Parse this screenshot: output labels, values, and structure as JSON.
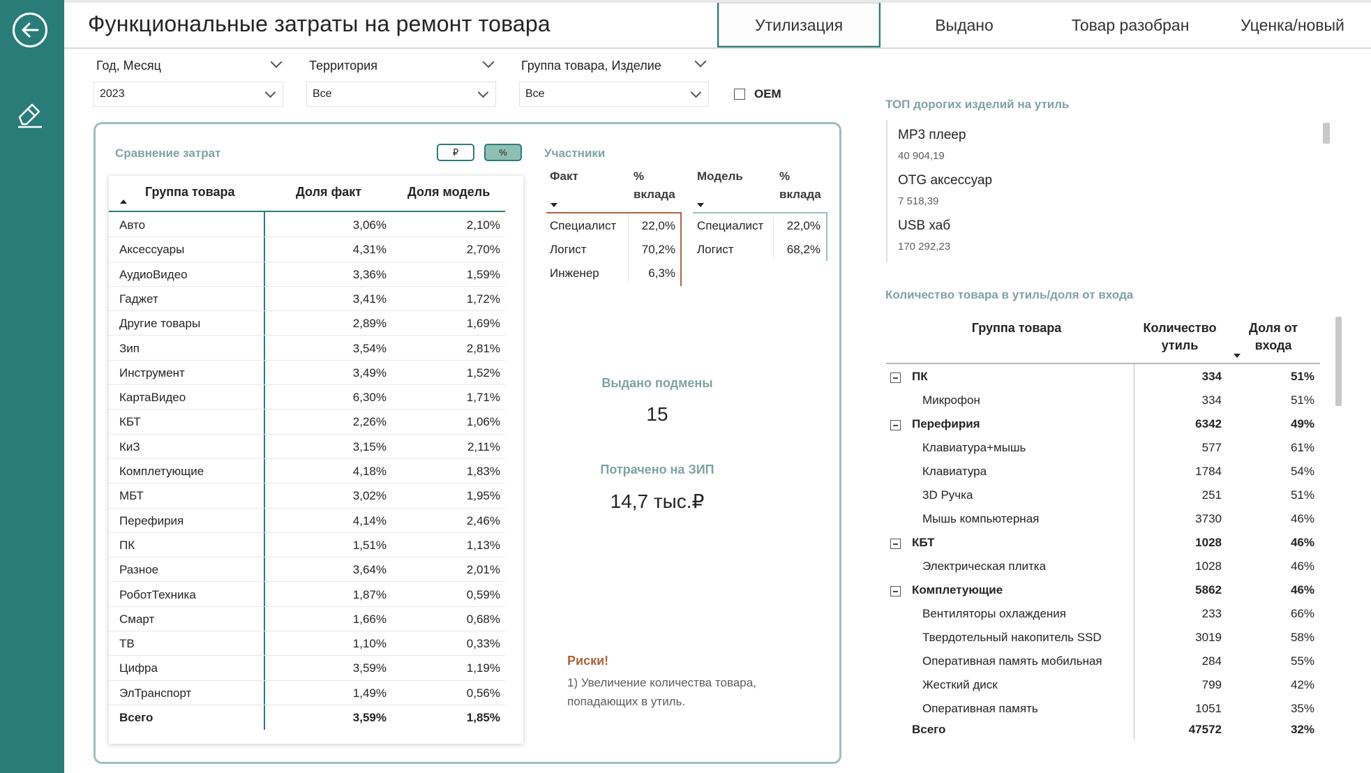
{
  "header": {
    "title": "Функциональные затраты на ремонт товара",
    "tabs": [
      {
        "label": "Утилизация",
        "active": true
      },
      {
        "label": "Выдано",
        "active": false
      },
      {
        "label": "Товар разобран",
        "active": false
      },
      {
        "label": "Уценка/новый",
        "active": false
      }
    ]
  },
  "sidebar": {
    "back_icon": "arrow-left-circle-icon",
    "clear_icon": "eraser-icon"
  },
  "filters": {
    "year_month": {
      "label": "Год, Месяц",
      "value": "2023"
    },
    "territory": {
      "label": "Территория",
      "value": "Все"
    },
    "product_group": {
      "label": "Группа товара, Изделие",
      "value": "Все"
    },
    "oem": {
      "label": "OEM",
      "checked": false
    }
  },
  "comparison": {
    "title": "Сравнение затрат",
    "toggle_rub": "₽",
    "toggle_pct": "%",
    "columns": [
      "Группа товара",
      "Доля факт",
      "Доля модель"
    ],
    "rows": [
      [
        "Авто",
        "3,06%",
        "2,10%"
      ],
      [
        "Аксессуары",
        "4,31%",
        "2,70%"
      ],
      [
        "АудиоВидео",
        "3,36%",
        "1,59%"
      ],
      [
        "Гаджет",
        "3,41%",
        "1,72%"
      ],
      [
        "Другие товары",
        "2,89%",
        "1,69%"
      ],
      [
        "Зип",
        "3,54%",
        "2,81%"
      ],
      [
        "Инструмент",
        "3,49%",
        "1,52%"
      ],
      [
        "КартаВидео",
        "6,30%",
        "1,71%"
      ],
      [
        "КБТ",
        "2,26%",
        "1,06%"
      ],
      [
        "КиЗ",
        "3,15%",
        "2,11%"
      ],
      [
        "Комплетующие",
        "4,18%",
        "1,83%"
      ],
      [
        "МБТ",
        "3,02%",
        "1,95%"
      ],
      [
        "Перефирия",
        "4,14%",
        "2,46%"
      ],
      [
        "ПК",
        "1,51%",
        "1,13%"
      ],
      [
        "Разное",
        "3,64%",
        "2,01%"
      ],
      [
        "РоботТехника",
        "1,87%",
        "0,59%"
      ],
      [
        "Смарт",
        "1,66%",
        "0,68%"
      ],
      [
        "ТВ",
        "1,10%",
        "0,33%"
      ],
      [
        "Цифра",
        "3,59%",
        "1,19%"
      ],
      [
        "ЭлТранспорт",
        "1,49%",
        "0,56%"
      ]
    ],
    "total": [
      "Всего",
      "3,59%",
      "1,85%"
    ]
  },
  "participants": {
    "title": "Участники",
    "fact": {
      "col1": "Факт",
      "col2": "% вклада",
      "rows": [
        [
          "Специалист",
          "22,0%"
        ],
        [
          "Логист",
          "70,2%"
        ],
        [
          "Инженер",
          "6,3%"
        ]
      ]
    },
    "model": {
      "col1": "Модель",
      "col2": "% вклада",
      "rows": [
        [
          "Специалист",
          "22,0%"
        ],
        [
          "Логист",
          "68,2%"
        ]
      ]
    }
  },
  "kpis": {
    "replacements": {
      "label": "Выдано подмены",
      "value": "15"
    },
    "zip_spent": {
      "label": "Потрачено на ЗИП",
      "value": "14,7 тыс.₽"
    }
  },
  "risks": {
    "title": "Риски!",
    "line1": "1) Увеличение количества товара,",
    "line2": "попадающих в утиль."
  },
  "top_expensive": {
    "title": "ТОП дорогих изделий на утиль",
    "items": [
      {
        "name": "MP3 плеер",
        "value": "40 904,19"
      },
      {
        "name": "OTG аксессуар",
        "value": "7 518,39"
      },
      {
        "name": "USB хаб",
        "value": "170 292,23"
      }
    ]
  },
  "util_table": {
    "title": "Количество товара в утиль/доля от входа",
    "col_group": "Группа товара",
    "col_qty_1": "Количество",
    "col_qty_2": "утиль",
    "col_share_1": "Доля от",
    "col_share_2": "входа",
    "rows": [
      {
        "type": "group",
        "name": "ПК",
        "qty": "334",
        "share": "51%"
      },
      {
        "type": "item",
        "name": "Микрофон",
        "qty": "334",
        "share": "51%"
      },
      {
        "type": "group",
        "name": "Перефирия",
        "qty": "6342",
        "share": "49%"
      },
      {
        "type": "item",
        "name": "Клавиатура+мышь",
        "qty": "577",
        "share": "61%"
      },
      {
        "type": "item",
        "name": "Клавиатура",
        "qty": "1784",
        "share": "54%"
      },
      {
        "type": "item",
        "name": "3D Ручка",
        "qty": "251",
        "share": "51%"
      },
      {
        "type": "item",
        "name": "Мышь компьютерная",
        "qty": "3730",
        "share": "46%"
      },
      {
        "type": "group",
        "name": "КБТ",
        "qty": "1028",
        "share": "46%"
      },
      {
        "type": "item",
        "name": "Электрическая плитка",
        "qty": "1028",
        "share": "46%"
      },
      {
        "type": "group",
        "name": "Комплетующие",
        "qty": "5862",
        "share": "46%"
      },
      {
        "type": "item",
        "name": "Вентиляторы охлаждения",
        "qty": "233",
        "share": "66%"
      },
      {
        "type": "item",
        "name": "Твердотельный накопитель SSD",
        "qty": "3019",
        "share": "58%"
      },
      {
        "type": "item",
        "name": "Оперативная память мобильная",
        "qty": "284",
        "share": "55%"
      },
      {
        "type": "item",
        "name": "Жесткий диск",
        "qty": "799",
        "share": "42%"
      },
      {
        "type": "item",
        "name": "Оперативная память",
        "qty": "1051",
        "share": "35%"
      }
    ],
    "total": {
      "name": "Всего",
      "qty": "47572",
      "share": "32%"
    }
  },
  "colors": {
    "accent": "#2a7c78",
    "section_title": "#7fa3a1",
    "risk": "#b0643f",
    "panel_border": "#9dbfbd"
  }
}
